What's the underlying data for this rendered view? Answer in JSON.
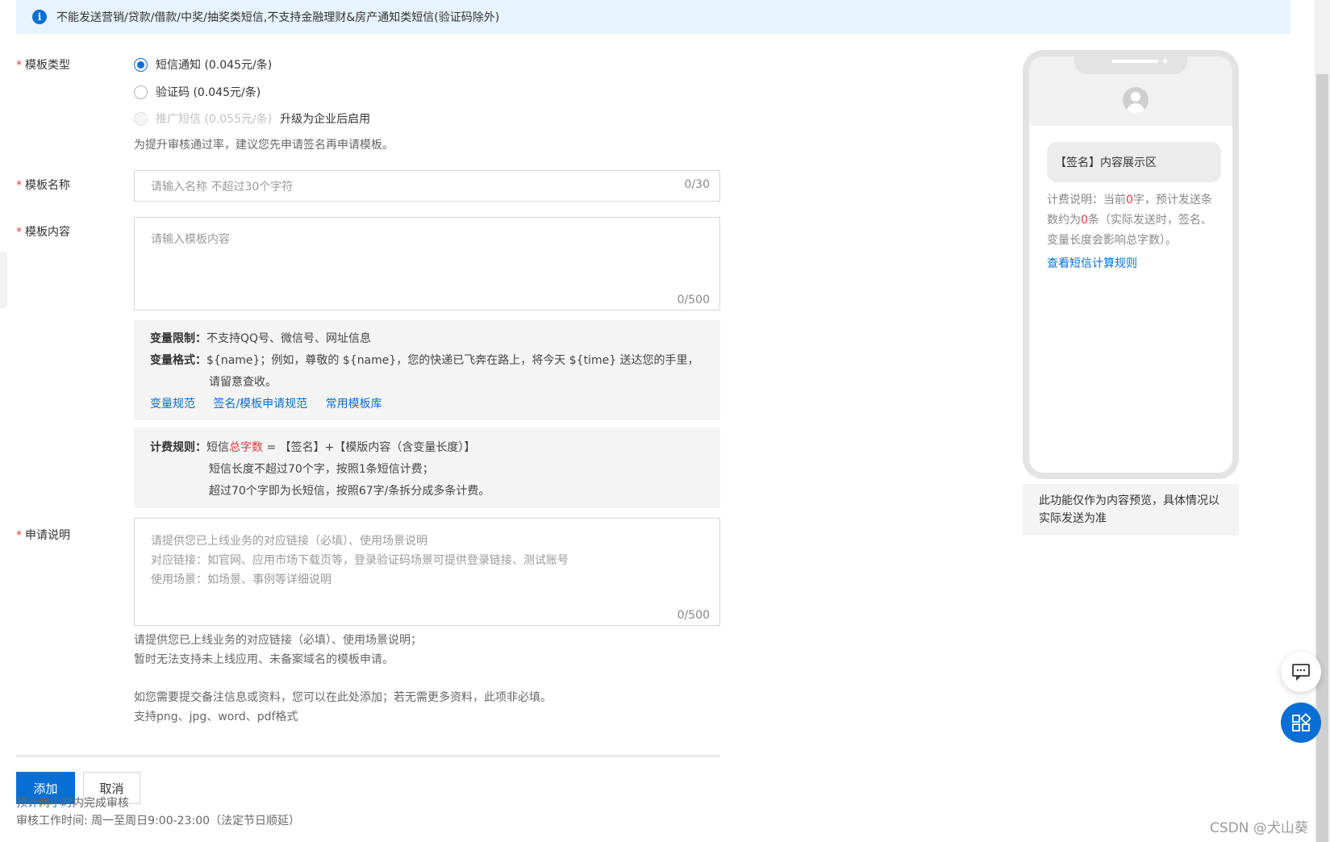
{
  "notice": {
    "text": "不能发送营销/贷款/借款/中奖/抽奖类短信,不支持金融理财&房产通知类短信(验证码除外)"
  },
  "form": {
    "required_mark": "*",
    "template_type": {
      "label": "模板类型",
      "options": [
        {
          "label": "短信通知 (0.045元/条)",
          "checked": true,
          "disabled": false
        },
        {
          "label": "验证码 (0.045元/条)",
          "checked": false,
          "disabled": false
        },
        {
          "label": "推广短信 (0.055元/条)",
          "checked": false,
          "disabled": true
        }
      ],
      "upgrade_text": "升级为企业后启用",
      "hint": "为提升审核通过率，建议您先申请签名再申请模板。"
    },
    "template_name": {
      "label": "模板名称",
      "placeholder": "请输入名称 不超过30个字符",
      "counter": "0/30"
    },
    "template_content": {
      "label": "模板内容",
      "placeholder": "请输入模板内容",
      "counter": "0/500"
    },
    "variable_panel": {
      "limit_label": "变量限制：",
      "limit_text": "不支持QQ号、微信号、网址信息",
      "format_label": "变量格式：",
      "format_text": "${name}；例如，尊敬的 ${name}，您的快递已飞奔在路上，将今天 ${time} 送达您的手里，",
      "format_text2": "请留意查收。",
      "links": [
        "变量规范",
        "签名/模板申请规范",
        "常用模板库"
      ]
    },
    "billing_panel": {
      "label": "计费规则：",
      "line1_prefix": "短信",
      "line1_red": "总字数",
      "line1_suffix": " = 【签名】+【模版内容（含变量长度）】",
      "line2": "短信长度不超过70个字，按照1条短信计费；",
      "line3": "超过70个字即为长短信，按照67字/条拆分成多条计费。"
    },
    "application": {
      "label": "申请说明",
      "placeholder_lines": [
        "请提供您已上线业务的对应链接（必填）、使用场景说明",
        "对应链接：如官网、应用市场下载页等，登录验证码场景可提供登录链接、测试账号",
        "使用场景：如场景、事例等详细说明"
      ],
      "counter": "0/500",
      "hint_lines": [
        "请提供您已上线业务的对应链接（必填）、使用场景说明；",
        "暂时无法支持未上线应用、未备案域名的模板申请。"
      ],
      "attach_lines": [
        "如您需要提交备注信息或资料，您可以在此处添加；若无需更多资料，此项非必填。",
        "支持png、jpg、word、pdf格式"
      ]
    },
    "buttons": {
      "add": "添加",
      "cancel": "取消"
    },
    "footer": {
      "review_time": "预计两小时内完成审核",
      "work_hours": "审核工作时间: 周一至周日9:00-23:00（法定节日顺延）"
    }
  },
  "preview": {
    "bubble": "【签名】内容展示区",
    "billing_prefix": "计费说明：当前",
    "char_count": "0",
    "billing_mid": "字，预计发送条数约为",
    "msg_count": "0",
    "billing_suffix": "条（实际发送时，签名、变量长度会影响总字数）。",
    "rule_link": "查看短信计算规则",
    "note": "此功能仅作为内容预览，具体情况以实际发送为准"
  },
  "watermark": "CSDN @犬山葵",
  "colors": {
    "primary": "#0a6fd4",
    "required": "#e4393c",
    "notice_bg": "#e7f3fd"
  },
  "icons": {
    "notice": "info-icon",
    "avatar": "user-avatar-icon",
    "chat": "chat-icon",
    "apps": "apps-grid-icon"
  }
}
